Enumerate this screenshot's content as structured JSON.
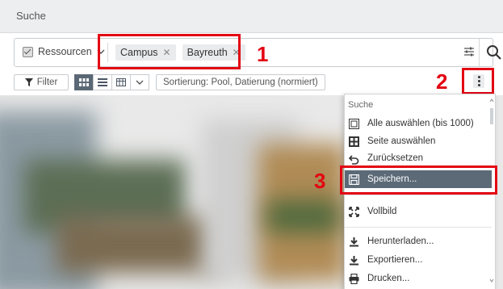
{
  "panel": {
    "title": "Suche"
  },
  "search": {
    "resource_label": "Ressourcen",
    "tags": [
      {
        "label": "Campus"
      },
      {
        "label": "Bayreuth"
      }
    ]
  },
  "toolbar": {
    "filter_label": "Filter",
    "sort_label": "Sortierung: Pool, Datierung (normiert)"
  },
  "annotations": {
    "n1": "1",
    "n2": "2",
    "n3": "3"
  },
  "menu": {
    "header": "Suche",
    "items": [
      {
        "label": "Alle auswählen (bis 1000)",
        "icon": "select-all-icon"
      },
      {
        "label": "Seite auswählen",
        "icon": "select-page-icon"
      },
      {
        "label": "Zurücksetzen",
        "icon": "undo-icon"
      },
      {
        "label": "Speichern...",
        "icon": "save-icon",
        "selected": true
      },
      {
        "label": "Vollbild",
        "icon": "fullscreen-icon"
      },
      {
        "label": "Herunterladen...",
        "icon": "download-icon"
      },
      {
        "label": "Exportieren...",
        "icon": "export-icon"
      },
      {
        "label": "Drucken...",
        "icon": "print-icon"
      }
    ]
  },
  "colors": {
    "accent_red": "#e30613",
    "selected_bg": "#5c6a78"
  }
}
